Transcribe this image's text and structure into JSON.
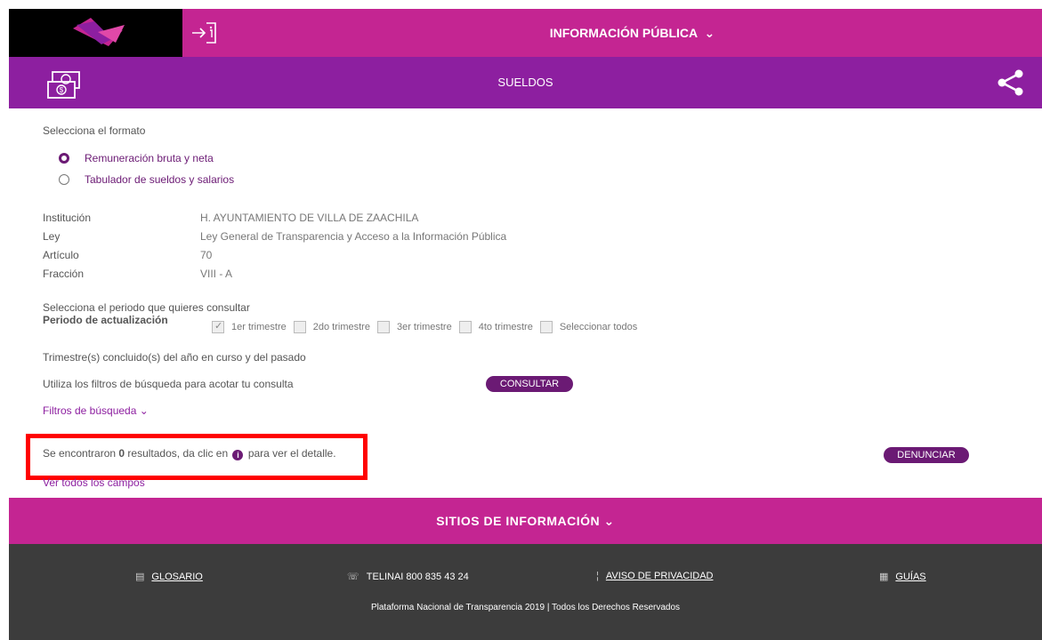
{
  "header": {
    "title": "INFORMACIÓN PÚBLICA",
    "chevron": "⌄"
  },
  "section": {
    "title": "SUELDOS"
  },
  "format": {
    "prompt": "Selecciona el formato",
    "options": [
      {
        "label": "Remuneración bruta y neta",
        "selected": true
      },
      {
        "label": "Tabulador de sueldos y salarios",
        "selected": false
      }
    ]
  },
  "info": {
    "institucion_key": "Institución",
    "institucion_val": "H. AYUNTAMIENTO DE VILLA DE ZAACHILA",
    "ley_key": "Ley",
    "ley_val": "Ley General de Transparencia y Acceso a la Información Pública",
    "articulo_key": "Artículo",
    "articulo_val": "70",
    "fraccion_key": "Fracción",
    "fraccion_val": "VIII - A"
  },
  "periodo": {
    "prompt": "Selecciona el periodo que quieres consultar",
    "label": "Periodo de actualización",
    "options": [
      "1er trimestre",
      "2do trimestre",
      "3er trimestre",
      "4to trimestre",
      "Seleccionar todos"
    ],
    "checked": [
      true,
      false,
      false,
      false,
      false
    ],
    "note": "Trimestre(s) concluido(s) del año en curso y del pasado"
  },
  "filters": {
    "hint": "Utiliza los filtros de búsqueda para acotar tu consulta",
    "consultar": "CONSULTAR",
    "toggle": "Filtros de búsqueda",
    "toggle_chevron": "⌄"
  },
  "results": {
    "prefix": "Se encontraron ",
    "count": "0",
    "middle": " resultados, da clic en ",
    "info_glyph": "i",
    "suffix": " para ver el detalle.",
    "denunciar": "DENUNCIAR",
    "ver_todos": "Ver todos los campos"
  },
  "sitios": {
    "title": "SITIOS DE INFORMACIÓN",
    "chevron": "⌄"
  },
  "footer": {
    "glosario": "GLOSARIO",
    "telinai": "TELINAI 800 835 43 24",
    "aviso": "AVISO DE PRIVACIDAD",
    "guias": "GUÍAS",
    "copyright": "Plataforma Nacional de Transparencia 2019 | Todos los Derechos Reservados"
  },
  "colors": {
    "magenta": "#c42592",
    "purple": "#8d1fa0",
    "dark_purple": "#6b1a74",
    "footer": "#3c3c3c",
    "highlight": "#ff0000"
  }
}
